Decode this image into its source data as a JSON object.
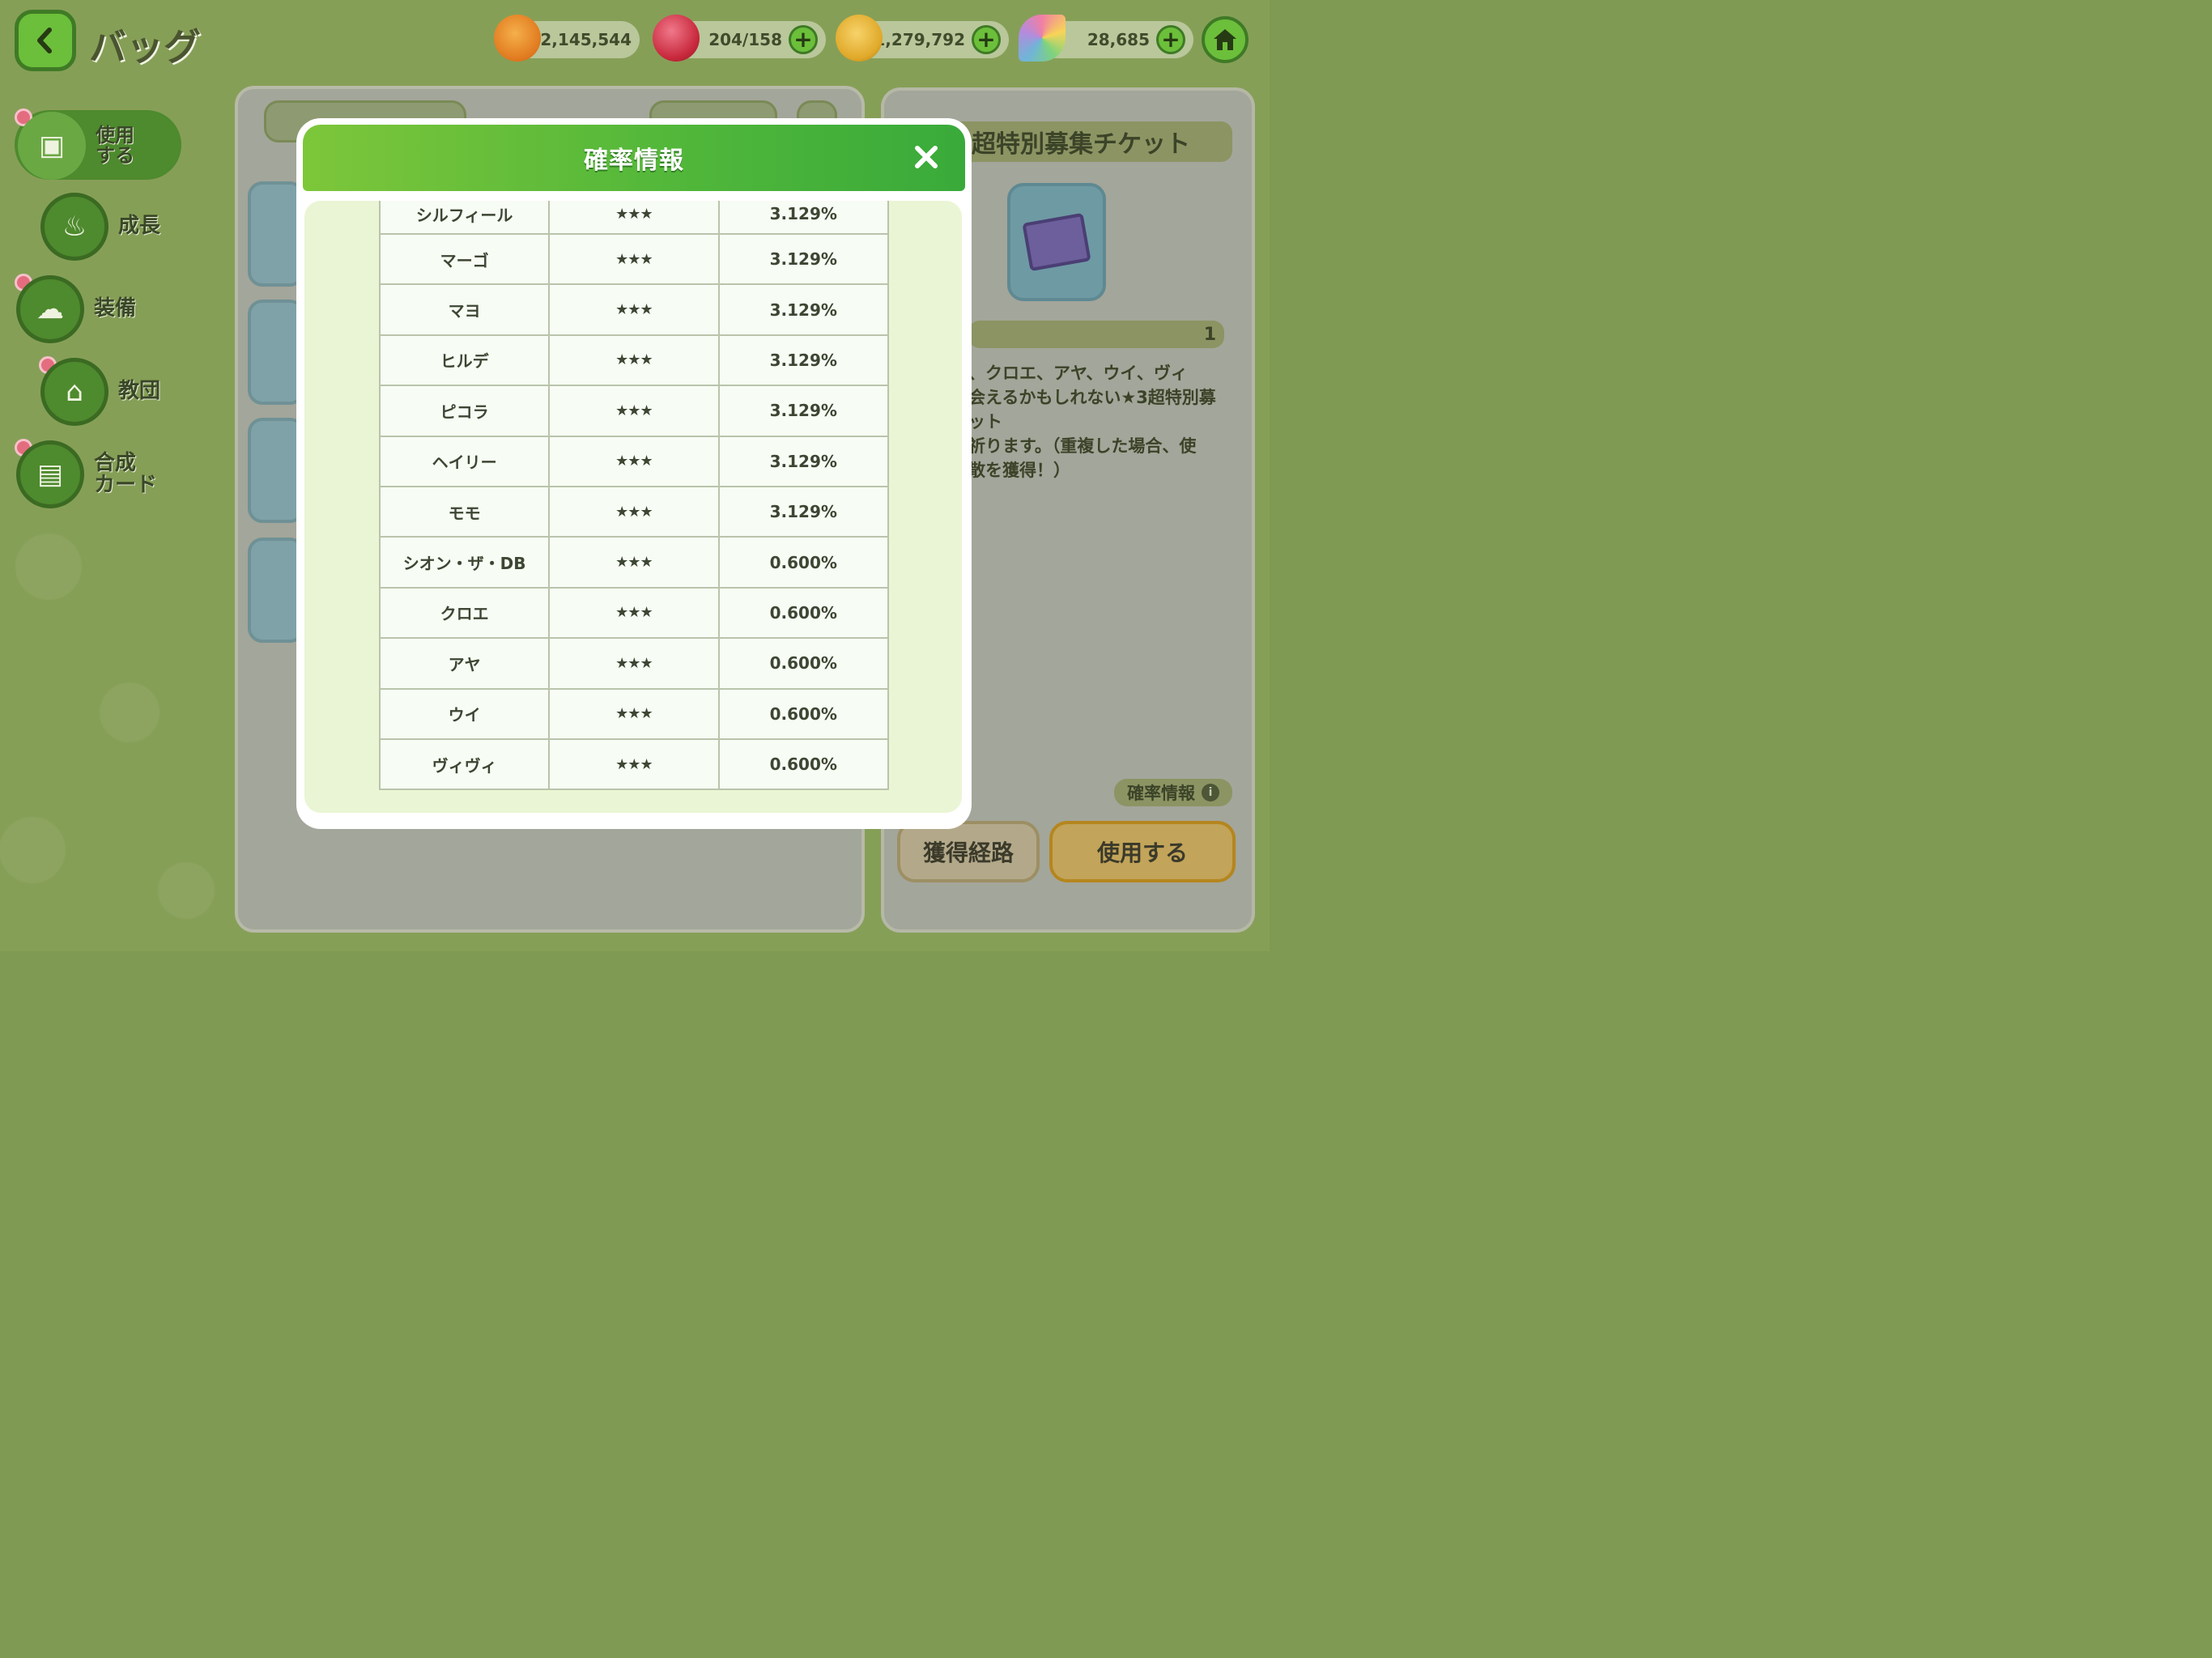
{
  "header": {
    "title": "バッグ",
    "currencies": [
      {
        "name": "orange-macaron",
        "value": "2,145,544",
        "has_plus": false,
        "color": "#e58a2a"
      },
      {
        "name": "red-candy",
        "value": "204/158",
        "has_plus": true,
        "color": "#c8283c"
      },
      {
        "name": "gold-coin",
        "value": "1,279,792",
        "has_plus": true,
        "color": "#e0a92a"
      },
      {
        "name": "rainbow-leaf",
        "value": "28,685",
        "has_plus": true,
        "color": "#6fb5d8"
      }
    ]
  },
  "sidebar": {
    "items": [
      {
        "label": "使用\nする",
        "icon": "chest-icon",
        "active": true
      },
      {
        "label": "成長",
        "icon": "potion-icon",
        "active": false
      },
      {
        "label": "装備",
        "icon": "hat-icon",
        "active": false
      },
      {
        "label": "教団",
        "icon": "church-icon",
        "active": false
      },
      {
        "label": "合成\nカード",
        "icon": "card-icon",
        "active": false
      }
    ]
  },
  "detail": {
    "title_fragment": "3超特別募集チケット",
    "count": "1",
    "description": "、クロエ、アヤ、ウイ、ヴィ\n会えるかもしれない★3超特別募\nット\n祈ります。（重複した場合、使\n散を獲得！）",
    "rate_info_link": "確率情報",
    "route_button": "獲得経路",
    "use_button": "使用する"
  },
  "modal": {
    "title": "確率情報",
    "rows": [
      {
        "name": "シルフィール",
        "rarity": "★★★",
        "rate": "3.129%"
      },
      {
        "name": "マーゴ",
        "rarity": "★★★",
        "rate": "3.129%"
      },
      {
        "name": "マヨ",
        "rarity": "★★★",
        "rate": "3.129%"
      },
      {
        "name": "ヒルデ",
        "rarity": "★★★",
        "rate": "3.129%"
      },
      {
        "name": "ピコラ",
        "rarity": "★★★",
        "rate": "3.129%"
      },
      {
        "name": "ヘイリー",
        "rarity": "★★★",
        "rate": "3.129%"
      },
      {
        "name": "モモ",
        "rarity": "★★★",
        "rate": "3.129%"
      },
      {
        "name": "シオン・ザ・DB",
        "rarity": "★★★",
        "rate": "0.600%"
      },
      {
        "name": "クロエ",
        "rarity": "★★★",
        "rate": "0.600%"
      },
      {
        "name": "アヤ",
        "rarity": "★★★",
        "rate": "0.600%"
      },
      {
        "name": "ウイ",
        "rarity": "★★★",
        "rate": "0.600%"
      },
      {
        "name": "ヴィヴィ",
        "rarity": "★★★",
        "rate": "0.600%"
      }
    ]
  }
}
